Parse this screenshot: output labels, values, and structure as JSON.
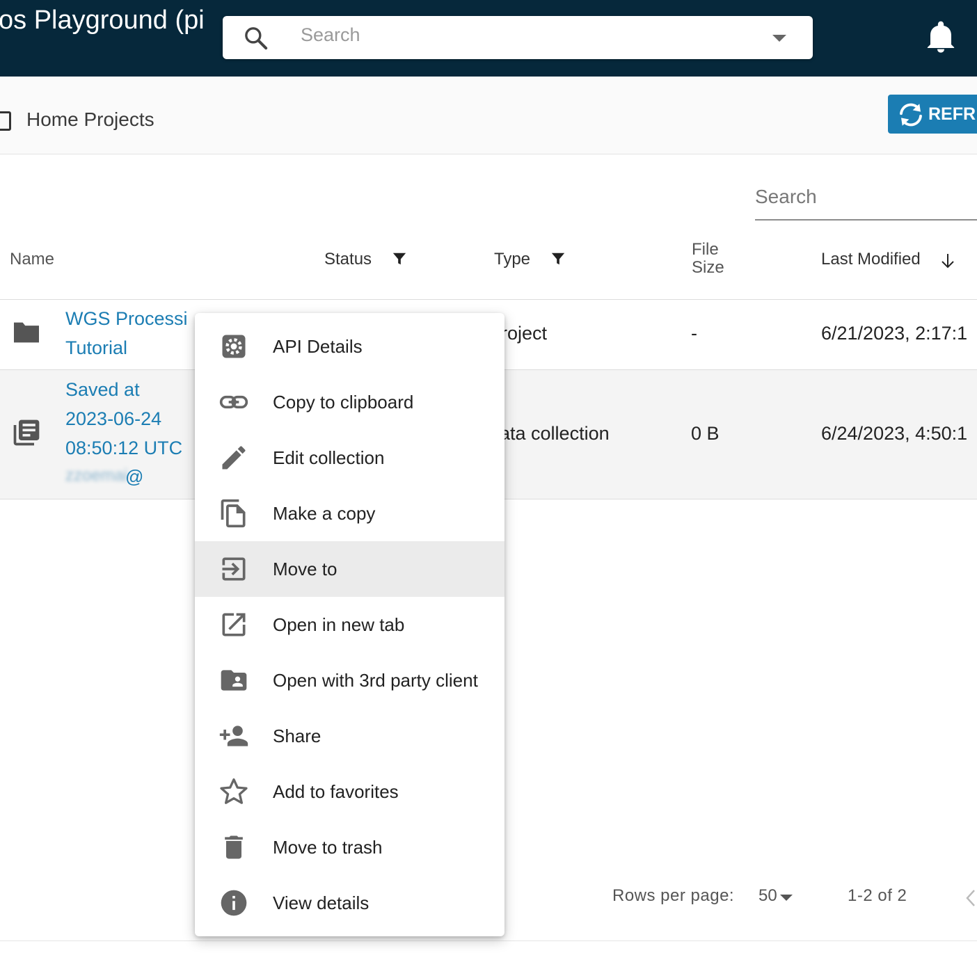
{
  "appbar": {
    "title": "os Playground (pi",
    "search_placeholder": "Search",
    "icons": [
      "search-icon",
      "dropdown-arrow-icon",
      "bell-icon"
    ]
  },
  "breadcrumb": {
    "label": "Home Projects",
    "refresh_label": "REFR"
  },
  "table": {
    "search_placeholder": "Search",
    "columns": {
      "name": "Name",
      "status": "Status",
      "type": "Type",
      "size": "File\nSize",
      "modified": "Last Modified"
    },
    "rows": [
      {
        "icon": "folder-icon",
        "name_line1": "WGS Processi",
        "name_line2": "Tutorial",
        "type": "roject",
        "size": "-",
        "modified": "6/21/2023, 2:17:1"
      },
      {
        "icon": "collection-icon",
        "name_line1": "Saved at",
        "name_line2": "2023-06-24",
        "name_line3": "08:50:12 UTC",
        "name_line4": "@",
        "type": "ata collection",
        "size": "0 B",
        "modified": "6/24/2023, 4:50:1"
      }
    ]
  },
  "pagination": {
    "rows_label": "Rows per page:",
    "rows_value": "50",
    "range": "1-2 of 2"
  },
  "context_menu": {
    "items": [
      {
        "label": "API Details",
        "icon": "gear-icon"
      },
      {
        "label": "Copy to clipboard",
        "icon": "link-icon"
      },
      {
        "label": "Edit collection",
        "icon": "pencil-icon"
      },
      {
        "label": "Make a copy",
        "icon": "copy-icon"
      },
      {
        "label": "Move to",
        "icon": "move-icon",
        "highlighted": true
      },
      {
        "label": "Open in new tab",
        "icon": "open-new-tab-icon"
      },
      {
        "label": "Open with 3rd party client",
        "icon": "shared-folder-icon"
      },
      {
        "label": "Share",
        "icon": "add-person-icon"
      },
      {
        "label": "Add to favorites",
        "icon": "star-icon"
      },
      {
        "label": "Move to trash",
        "icon": "trash-icon"
      },
      {
        "label": "View details",
        "icon": "info-icon"
      }
    ]
  },
  "colors": {
    "appbar": "#06283b",
    "accent": "#1b7db3",
    "menu_highlight": "#ebebeb"
  }
}
